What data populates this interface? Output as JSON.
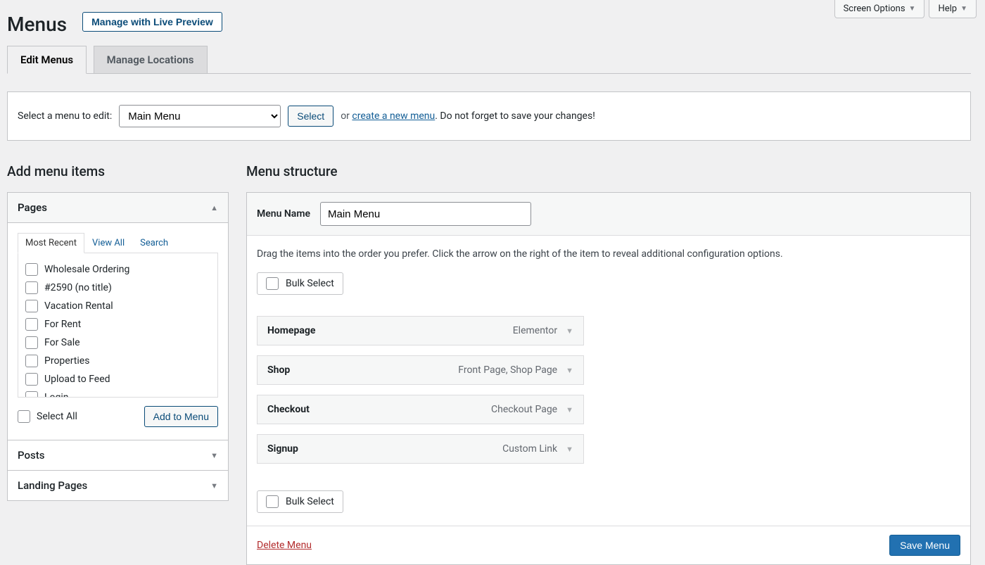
{
  "top": {
    "screen_options": "Screen Options",
    "help": "Help"
  },
  "header": {
    "title": "Menus",
    "live_preview": "Manage with Live Preview"
  },
  "tabs": {
    "edit": "Edit Menus",
    "locations": "Manage Locations"
  },
  "selector": {
    "label": "Select a menu to edit:",
    "current": "Main Menu",
    "select_btn": "Select",
    "or": "or",
    "create_link": "create a new menu",
    "reminder": ". Do not forget to save your changes!"
  },
  "left": {
    "heading": "Add menu items",
    "pages_title": "Pages",
    "page_tabs": {
      "recent": "Most Recent",
      "view_all": "View All",
      "search": "Search"
    },
    "pages": [
      "Wholesale Ordering",
      "#2590 (no title)",
      "Vacation Rental",
      "For Rent",
      "For Sale",
      "Properties",
      "Upload to Feed",
      "Login"
    ],
    "select_all": "Select All",
    "add_btn": "Add to Menu",
    "posts_title": "Posts",
    "landing_title": "Landing Pages"
  },
  "right": {
    "heading": "Menu structure",
    "name_label": "Menu Name",
    "name_value": "Main Menu",
    "instructions": "Drag the items into the order you prefer. Click the arrow on the right of the item to reveal additional configuration options.",
    "bulk": "Bulk Select",
    "items": [
      {
        "title": "Homepage",
        "type": "Elementor"
      },
      {
        "title": "Shop",
        "type": "Front Page, Shop Page"
      },
      {
        "title": "Checkout",
        "type": "Checkout Page"
      },
      {
        "title": "Signup",
        "type": "Custom Link"
      }
    ],
    "delete": "Delete Menu",
    "save": "Save Menu"
  }
}
